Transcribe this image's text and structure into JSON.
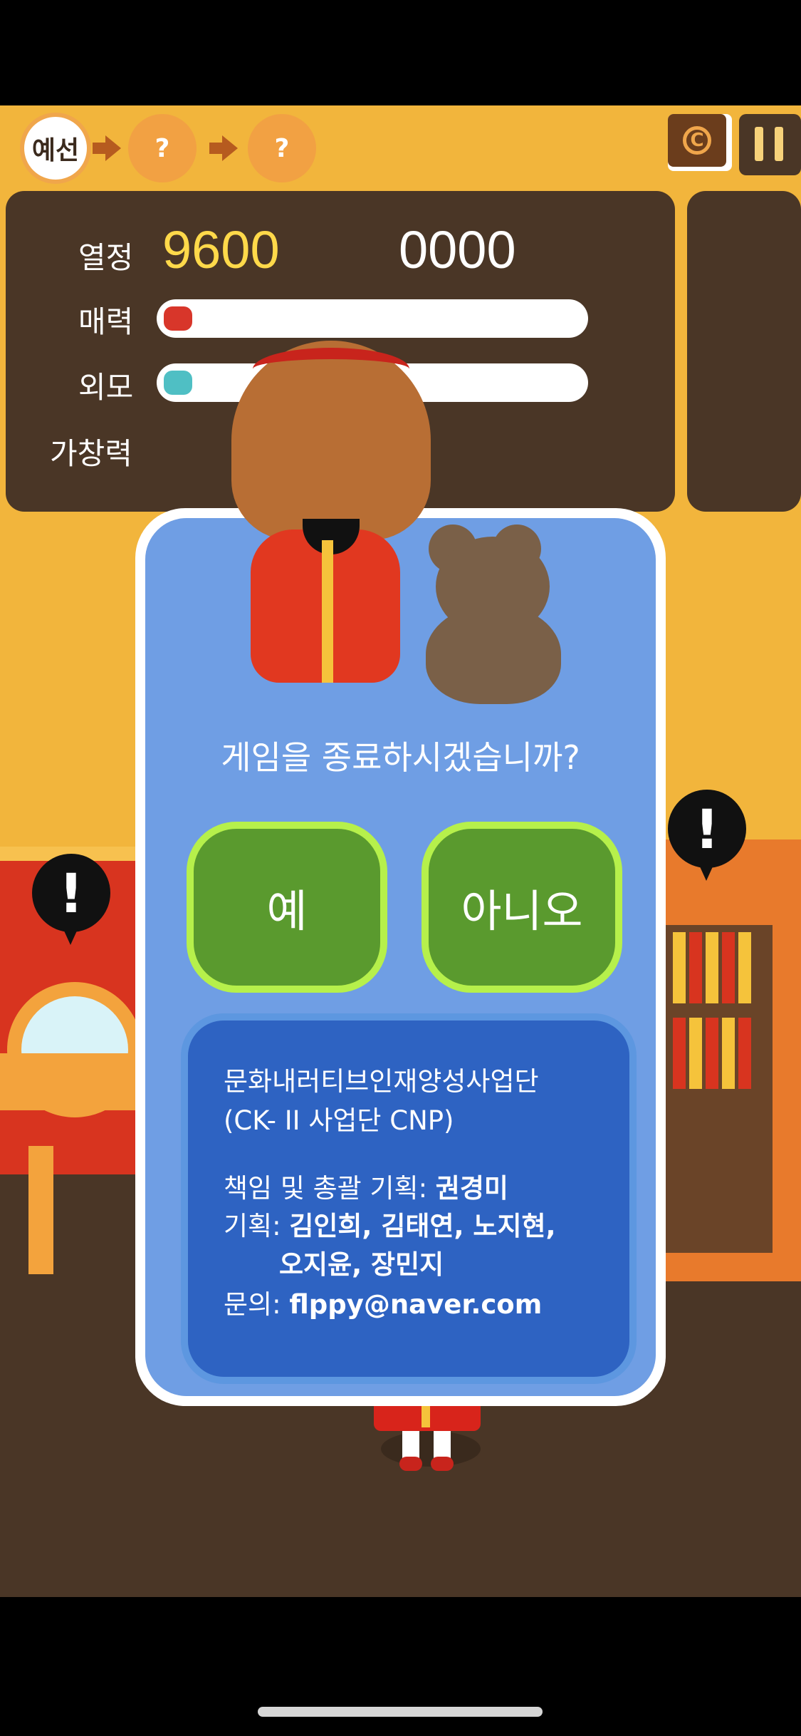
{
  "stage": {
    "current": "예선",
    "next_1": "?",
    "next_2": "?"
  },
  "stats": {
    "passion_label": "열정",
    "passion_value": "9600",
    "passion_max": "0000",
    "charm_label": "매력",
    "looks_label": "외모",
    "singing_label": "가창력",
    "charm_color": "#d8362a",
    "looks_color": "#4fbfc4"
  },
  "dialog": {
    "title": "게임을 종료하시겠습니까?",
    "yes_label": "예",
    "no_label": "아니오",
    "credits": {
      "org_line1": "문화내러티브인재양성사업단",
      "org_line2": "(CK- II 사업단 CNP)",
      "lead_label": "책임 및 총괄 기획: ",
      "lead_name": "권경미",
      "plan_label": "기획: ",
      "plan_names_1": "김인희, 김태연, 노지현,",
      "plan_names_2": "오지윤, 장민지",
      "contact_label": "문의: ",
      "contact_email": "flppy@naver.com"
    }
  },
  "scene": {
    "alert_left": "!",
    "alert_right": "!"
  },
  "icons": {
    "book": "book-icon",
    "book_glyph": "C",
    "pause": "pause-icon"
  },
  "colors": {
    "background": "#f2b53c",
    "panel": "#4a3626",
    "dialog": "#6f9ee4",
    "button": "#5a9a2e",
    "button_border": "#b6f04b",
    "info_box": "#2e63c2"
  }
}
